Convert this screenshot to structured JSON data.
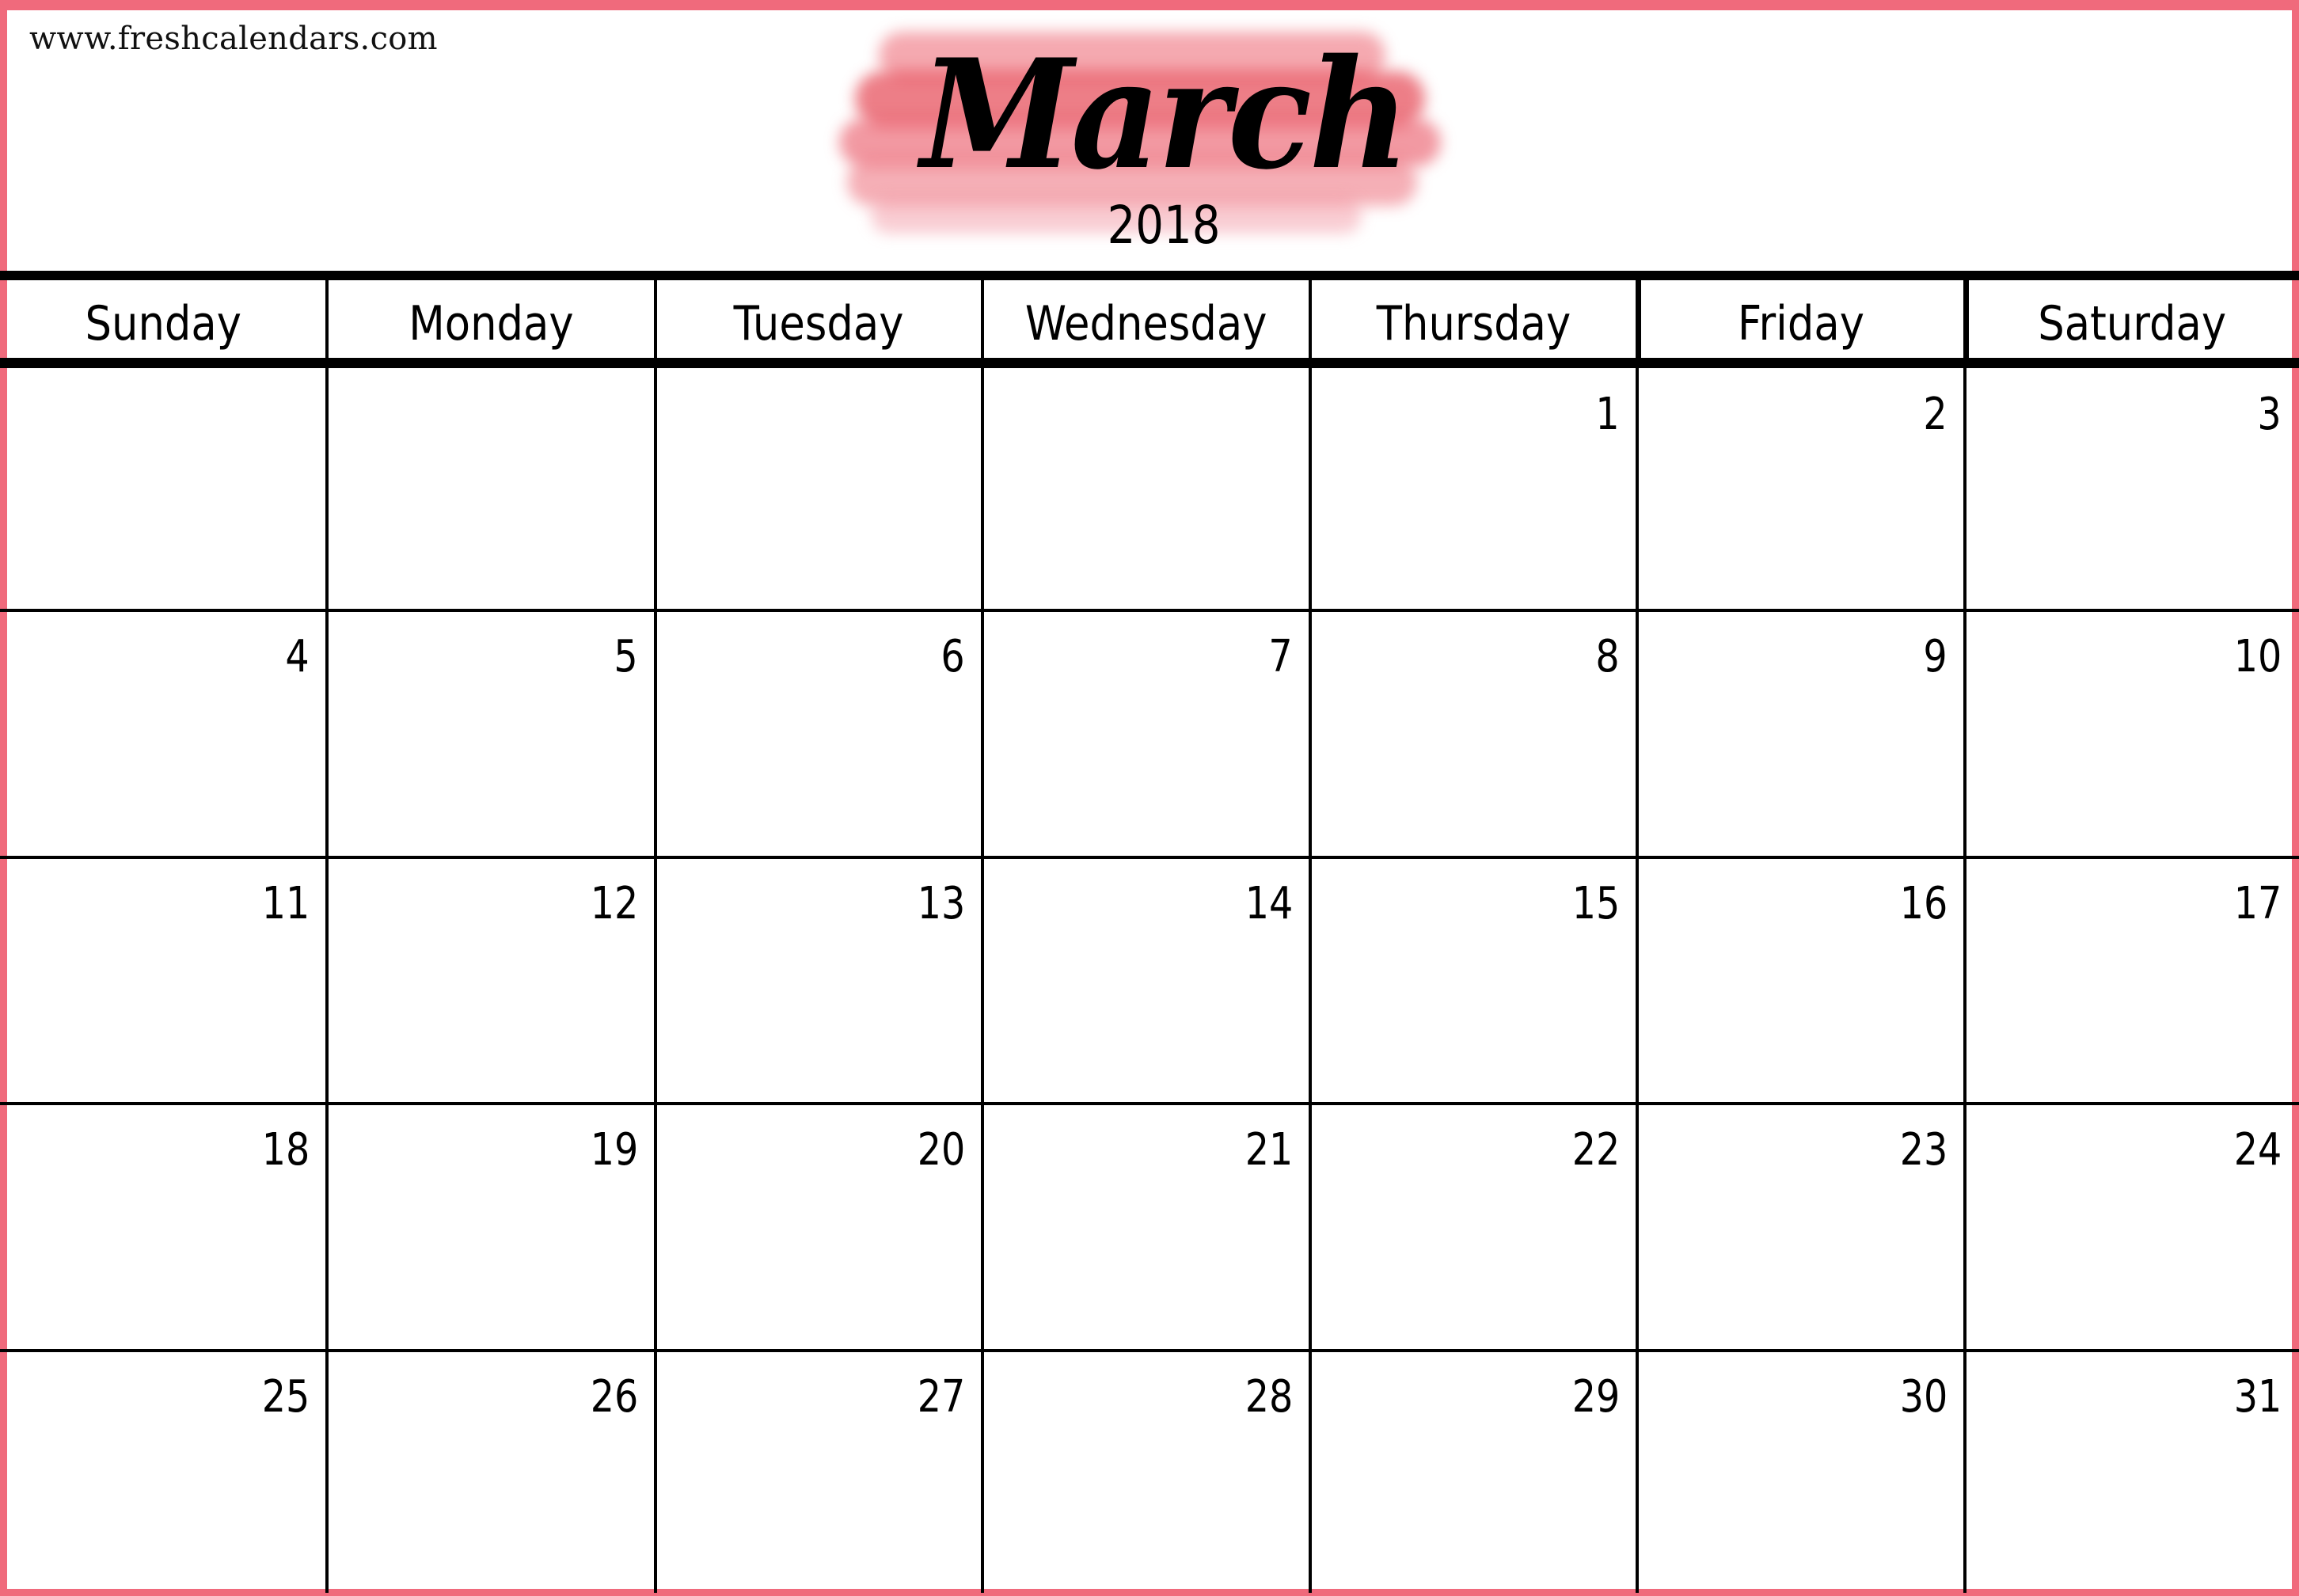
{
  "site": {
    "url": "www.freshcalendars.com"
  },
  "header": {
    "month": "March",
    "year": "2018"
  },
  "colors": {
    "border": "#f06a7c",
    "brush": "#e8404f",
    "grid": "#000000"
  },
  "weekdays": [
    "Sunday",
    "Monday",
    "Tuesday",
    "Wednesday",
    "Thursday",
    "Friday",
    "Saturday"
  ],
  "weeks": [
    [
      "",
      "",
      "",
      "",
      "1",
      "2",
      "3"
    ],
    [
      "4",
      "5",
      "6",
      "7",
      "8",
      "9",
      "10"
    ],
    [
      "11",
      "12",
      "13",
      "14",
      "15",
      "16",
      "17"
    ],
    [
      "18",
      "19",
      "20",
      "21",
      "22",
      "23",
      "24"
    ],
    [
      "25",
      "26",
      "27",
      "28",
      "29",
      "30",
      "31"
    ]
  ]
}
